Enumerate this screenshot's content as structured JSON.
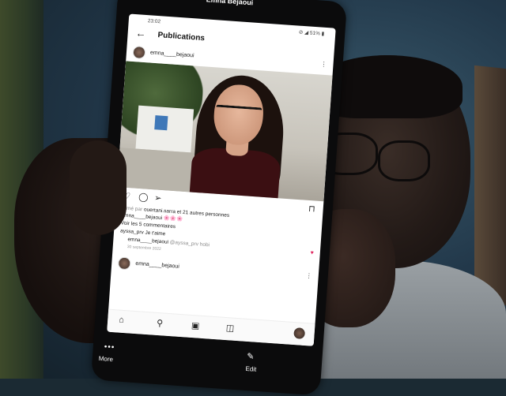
{
  "messenger": {
    "back_icon": "back-arrow-icon",
    "contact_name": "Emna Bejaoui",
    "more_label": "More",
    "edit_label": "Edit"
  },
  "screen": {
    "status": {
      "time": "23:02",
      "indicators": "⊘ ◢ 51% ▮"
    },
    "appbar": {
      "title": "Publications"
    },
    "post": {
      "username": "emna____bejaoui",
      "liked_by_prefix": "Aimé par ",
      "liked_by_user": "ouertani.sarra",
      "liked_by_suffix": " et 21 autres personnes",
      "caption_user": "emna____bejaoui",
      "caption_text": " 🌸🌸🌸",
      "view_comments": "Voir les 5 commentaires",
      "comment_user": "ayssa_prv",
      "comment_text": " Je t'aime",
      "reply_user": "emna____bejaoui",
      "reply_text": " @ayssa_prv hobi",
      "date": "30 septembre 2022"
    },
    "next_post": {
      "username": "emna____bejaoui"
    }
  },
  "colors": {
    "accent_heart": "#e0245e",
    "screen_bg": "#ffffff",
    "phone_body": "#0b0b0c"
  }
}
